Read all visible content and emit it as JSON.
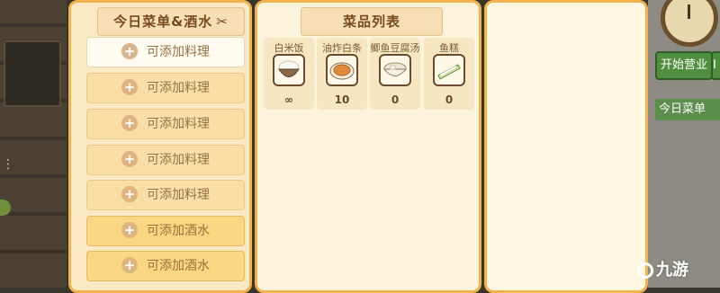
{
  "hud": {
    "open_button_label": "开始营业",
    "open_button_extra": "I",
    "today_menu_label": "今日菜单"
  },
  "left_panel": {
    "title": "今日菜单&酒水",
    "slots": [
      {
        "label": "可添加料理",
        "type": "food"
      },
      {
        "label": "可添加料理",
        "type": "food"
      },
      {
        "label": "可添加料理",
        "type": "food"
      },
      {
        "label": "可添加料理",
        "type": "food"
      },
      {
        "label": "可添加料理",
        "type": "food"
      },
      {
        "label": "可添加酒水",
        "type": "drink"
      },
      {
        "label": "可添加酒水",
        "type": "drink"
      }
    ],
    "plus_symbol": "+"
  },
  "mid_panel": {
    "title": "菜品列表",
    "dishes": [
      {
        "name": "白米饭",
        "count": "∞",
        "icon": "rice-bowl-icon"
      },
      {
        "name": "油炸白条",
        "count": "10",
        "icon": "fried-fish-plate-icon"
      },
      {
        "name": "鲫鱼豆腐汤",
        "count": "0",
        "icon": "tofu-soup-bowl-icon"
      },
      {
        "name": "鱼糕",
        "count": "0",
        "icon": "fish-cake-icon"
      }
    ]
  },
  "watermark": {
    "text": "九游"
  },
  "colors": {
    "panel_border": "#f0b34d",
    "slot_food": "#f7dfa5",
    "slot_drink": "#f9d681",
    "banner_text": "#7a4a1c"
  }
}
